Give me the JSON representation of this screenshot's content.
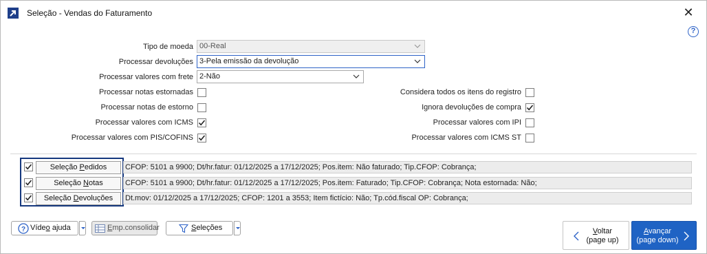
{
  "window": {
    "title": "Seleção - Vendas do Faturamento",
    "close_glyph": "✕",
    "help_glyph": "?"
  },
  "fields": {
    "tipo_moeda": {
      "label": "Tipo de moeda",
      "value": "00-Real"
    },
    "processar_devolucoes": {
      "label": "Processar devoluções",
      "value": "3-Pela emissão da devolução"
    },
    "processar_valores_frete": {
      "label": "Processar valores com frete",
      "value": "2-Não"
    }
  },
  "checkboxes_left": [
    {
      "label": "Processar notas estornadas",
      "checked": false
    },
    {
      "label": "Processar notas de estorno",
      "checked": false
    },
    {
      "label": "Processar valores com ICMS",
      "checked": true
    },
    {
      "label": "Processar valores com PIS/COFINS",
      "checked": true
    }
  ],
  "checkboxes_right": [
    {
      "label": "Considera todos os itens do registro",
      "checked": false
    },
    {
      "label": "Ignora devoluções de compra",
      "checked": true
    },
    {
      "label": "Processar valores com IPI",
      "checked": false
    },
    {
      "label": "Processar valores com ICMS ST",
      "checked": false
    }
  ],
  "selections": [
    {
      "checked": true,
      "button_pre": "Seleção ",
      "button_mn": "P",
      "button_post": "edidos",
      "info": "CFOP: 5101 a 9900; Dt/hr.fatur: 01/12/2025 a 17/12/2025; Pos.item: Não faturado; Tip.CFOP: Cobrança;"
    },
    {
      "checked": true,
      "button_pre": "Seleção ",
      "button_mn": "N",
      "button_post": "otas",
      "info": "CFOP: 5101 a 9900; Dt/hr.fatur: 01/12/2025 a 17/12/2025; Pos.item: Faturado; Tip.CFOP: Cobrança; Nota estornada: Não;"
    },
    {
      "checked": true,
      "button_pre": "Seleção ",
      "button_mn": "D",
      "button_post": "evoluções",
      "info": "Dt.mov: 01/12/2025 a 17/12/2025; CFOP: 1201 a 3553; Item fictício: Não; Tp.cód.fiscal OP: Cobrança;"
    }
  ],
  "bottom": {
    "video_pre": "Víde",
    "video_mn": "o",
    "video_post": " ajuda",
    "emp_pre": "",
    "emp_mn": "E",
    "emp_post": "mp.consolidar",
    "sel_pre": "",
    "sel_mn": "S",
    "sel_post": "eleções",
    "voltar_pre": "",
    "voltar_mn": "V",
    "voltar_post": "oltar",
    "voltar_sub": "(page up)",
    "avancar_pre": "",
    "avancar_mn": "A",
    "avancar_post": "vançar",
    "avancar_sub": "(page down)"
  },
  "colors": {
    "accent": "#1f63c4",
    "selection_border": "#14377d",
    "help": "#2d62c7"
  },
  "icons": {
    "app": "app-arrow-icon",
    "close": "close-icon",
    "help": "help-icon",
    "video": "question-circle-icon",
    "emp": "table-icon",
    "filter": "filter-icon",
    "back": "chevron-left-icon",
    "next": "chevron-right-icon"
  }
}
